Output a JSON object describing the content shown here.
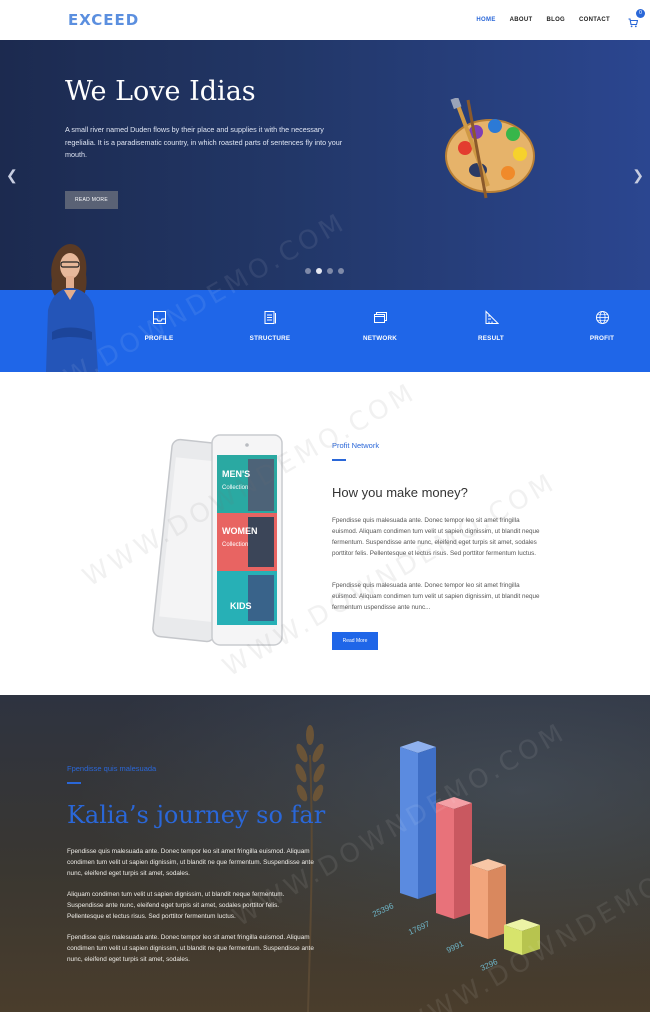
{
  "header": {
    "logo": "EXCEED",
    "nav": [
      {
        "label": "HOME",
        "active": true
      },
      {
        "label": "ABOUT",
        "active": false
      },
      {
        "label": "BLOG",
        "active": false
      },
      {
        "label": "CONTACT",
        "active": false
      }
    ],
    "cart_count": "0"
  },
  "hero": {
    "title": "We Love Idias",
    "text": "A small river named Duden flows by their place and supplies it with the necessary regelialia. It is a paradisematic country, in which roasted parts of sentences fly into your mouth.",
    "button": "READ MORE",
    "slides": 4,
    "active_slide": 2
  },
  "features": [
    {
      "label": "PROFILE",
      "icon": "inbox-icon"
    },
    {
      "label": "STRUCTURE",
      "icon": "document-icon"
    },
    {
      "label": "NETWORK",
      "icon": "windows-icon"
    },
    {
      "label": "RESULT",
      "icon": "ruler-icon"
    },
    {
      "label": "PROFIT",
      "icon": "globe-icon"
    }
  ],
  "money": {
    "eyebrow": "Profit Network",
    "title": "How you make money?",
    "p1": "Fpendisse quis malesuada ante. Donec tempor leo sit amet fringilla euismod. Aliquam condimen tum velit ut sapien dignissim, ut blandit neque fermentum. Suspendisse ante nunc, eleifend eget turpis sit amet, sodales porttitor felis. Pellentesque et lectus risus. Sed porttitor fermentum luctus.",
    "p2": "Fpendisse quis malesuada ante. Donec tempor leo sit amet fringilla euismod. Aliquam condimen tum velit ut sapien dignissim, ut blandit neque fermentum uspendisse ante nunc...",
    "button": "Read More",
    "phone_labels": [
      "MEN'S",
      "Collection",
      "WOMEN",
      "Collection",
      "KIDS"
    ]
  },
  "journey": {
    "eyebrow": "Fpendisse quis malesuada",
    "title": "Kalia’s journey so far",
    "p1": "Fpendisse quis malesuada ante. Donec tempor leo sit amet fringilla euismod. Aliquam condimen tum velit ut sapien dignissim, ut blandit ne que fermentum. Suspendisse ante nunc, eleifend eget turpis sit amet, sodales.",
    "p2": "Aliquam condimen tum velit ut sapien dignissim, ut blandit neque fermentum. Suspendisse ante nunc, eleifend eget turpis sit amet, sodales porttitor felis. Pellentesque et lectus risus. Sed porttitor fermentum luctus.",
    "p3": "Fpendisse quis malesuada ante. Donec tempor leo sit amet fringilla euismod. Aliquam condimen tum velit ut sapien dignissim, ut blandit ne que fermentum. Suspendisse ante nunc, eleifend eget turpis sit amet, sodales.",
    "bar_labels": [
      "25396",
      "17697",
      "9991",
      "3296"
    ],
    "bar_colors": [
      "#5b8be0",
      "#e8727a",
      "#f2a57c",
      "#d7e46c"
    ]
  },
  "watermark": "WWW.DOWNDEMO.COM"
}
